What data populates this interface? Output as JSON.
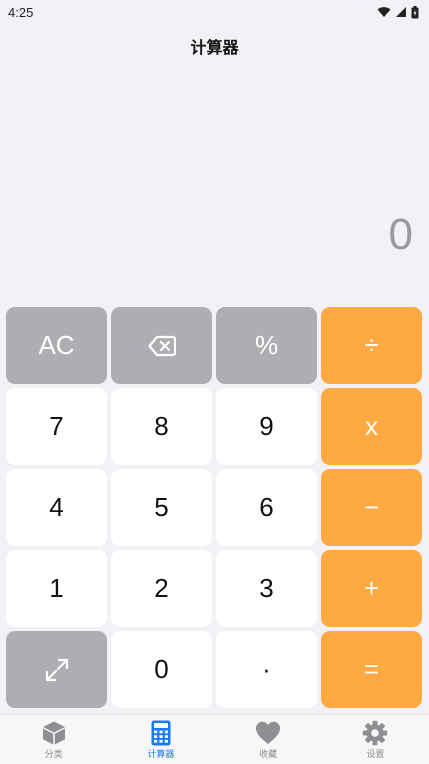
{
  "status_bar": {
    "time": "4:25",
    "icons": [
      "wifi-icon",
      "cellular-signal-icon",
      "battery-icon"
    ]
  },
  "header": {
    "title": "计算器"
  },
  "display": {
    "value": "0"
  },
  "keypad": {
    "rows": [
      [
        {
          "label": "AC",
          "kind": "function"
        },
        {
          "label": "",
          "icon": "backspace-icon",
          "kind": "function"
        },
        {
          "label": "%",
          "kind": "function"
        },
        {
          "label": "÷",
          "kind": "operator"
        }
      ],
      [
        {
          "label": "7",
          "kind": "digit"
        },
        {
          "label": "8",
          "kind": "digit"
        },
        {
          "label": "9",
          "kind": "digit"
        },
        {
          "label": "x",
          "kind": "operator"
        }
      ],
      [
        {
          "label": "4",
          "kind": "digit"
        },
        {
          "label": "5",
          "kind": "digit"
        },
        {
          "label": "6",
          "kind": "digit"
        },
        {
          "label": "−",
          "kind": "operator"
        }
      ],
      [
        {
          "label": "1",
          "kind": "digit"
        },
        {
          "label": "2",
          "kind": "digit"
        },
        {
          "label": "3",
          "kind": "digit"
        },
        {
          "label": "+",
          "kind": "operator"
        }
      ],
      [
        {
          "label": "",
          "icon": "expand-icon",
          "kind": "function"
        },
        {
          "label": "0",
          "kind": "digit"
        },
        {
          "label": "·",
          "kind": "digit"
        },
        {
          "label": "=",
          "kind": "operator"
        }
      ]
    ]
  },
  "tab_bar": {
    "tabs": [
      {
        "label": "分类",
        "icon": "cube-icon",
        "active": false
      },
      {
        "label": "计算器",
        "icon": "calculator-icon",
        "active": true
      },
      {
        "label": "收藏",
        "icon": "heart-icon",
        "active": false
      },
      {
        "label": "设置",
        "icon": "gear-icon",
        "active": false
      }
    ]
  },
  "colors": {
    "background": "#f2f1f6",
    "function_key": "#aeaeb2",
    "operator_key": "#fea941",
    "digit_key": "#ffffff",
    "active_tab": "#1a7af5",
    "inactive_tab": "#8e8e93"
  }
}
